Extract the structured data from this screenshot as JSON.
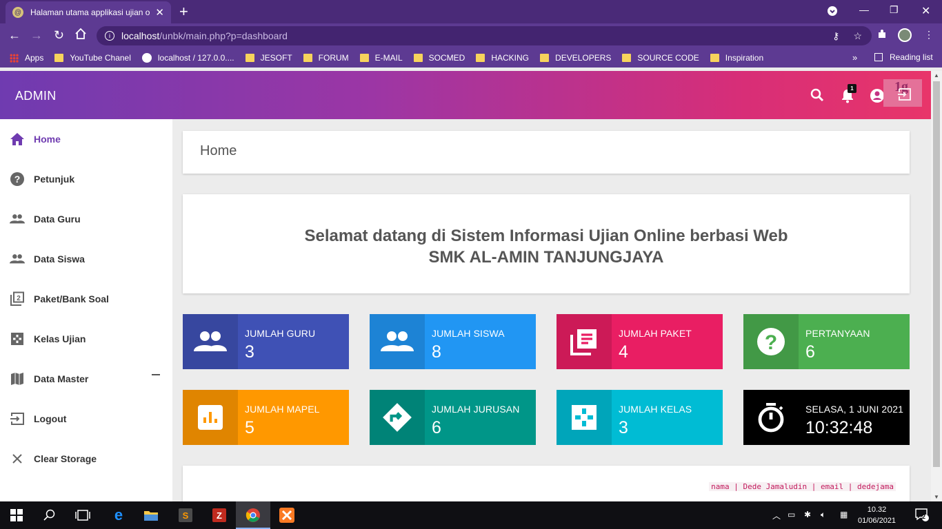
{
  "browser": {
    "tab_title": "Halaman utama applikasi ujian o",
    "url_host": "localhost",
    "url_path": "/unbk/main.php?p=dashboard",
    "bookmarks": [
      "Apps",
      "YouTube Chanel",
      "localhost / 127.0.0....",
      "JESOFT",
      "FORUM",
      "E-MAIL",
      "SOCMED",
      "HACKING",
      "DEVELOPERS",
      "SOURCE CODE",
      "Inspiration"
    ],
    "reading_list": "Reading list",
    "more": "»"
  },
  "header": {
    "brand": "ADMIN",
    "notification_count": "1",
    "logo_text": "1g",
    "gradient": [
      "#6f3bb0",
      "#e8356a"
    ]
  },
  "sidebar": {
    "items": [
      {
        "label": "Home",
        "icon": "home-icon"
      },
      {
        "label": "Petunjuk",
        "icon": "help-icon"
      },
      {
        "label": "Data Guru",
        "icon": "people-icon"
      },
      {
        "label": "Data Siswa",
        "icon": "people-icon"
      },
      {
        "label": "Paket/Bank Soal",
        "icon": "filter-2-icon"
      },
      {
        "label": "Kelas Ujian",
        "icon": "class-icon"
      },
      {
        "label": "Data Master",
        "icon": "map-icon"
      },
      {
        "label": "Logout",
        "icon": "logout-icon"
      },
      {
        "label": "Clear Storage",
        "icon": "close-icon"
      }
    ]
  },
  "main": {
    "page_title": "Home",
    "welcome_line1": "Selamat datang di Sistem Informasi Ujian Online berbasi Web",
    "welcome_line2": "SMK AL-AMIN TANJUNGJAYA",
    "tiles": [
      {
        "label": "JUMLAH GURU",
        "value": "3",
        "color": "#3f51b5",
        "icon": "people-icon"
      },
      {
        "label": "JUMLAH SISWA",
        "value": "8",
        "color": "#2196f3",
        "icon": "people-icon"
      },
      {
        "label": "JUMLAH PAKET",
        "value": "4",
        "color": "#e91e63",
        "icon": "library-books-icon"
      },
      {
        "label": "PERTANYAAN",
        "value": "6",
        "color": "#4caf50",
        "icon": "help-icon"
      },
      {
        "label": "JUMLAH MAPEL",
        "value": "5",
        "color": "#ff9800",
        "icon": "chart-icon"
      },
      {
        "label": "JUMLAH JURUSAN",
        "value": "6",
        "color": "#009688",
        "icon": "directions-icon"
      },
      {
        "label": "JUMLAH KELAS",
        "value": "3",
        "color": "#00bcd4",
        "icon": "class-icon"
      },
      {
        "label": "SELASA, 1 JUNI 2021",
        "value": "10:32:48",
        "color": "#000000",
        "icon": "timer-icon"
      }
    ],
    "footer_snippet": "nama | Dede Jamaludin | email | dedejama"
  },
  "taskbar": {
    "time": "10.32",
    "date": "01/06/2021",
    "notifications": "2"
  }
}
